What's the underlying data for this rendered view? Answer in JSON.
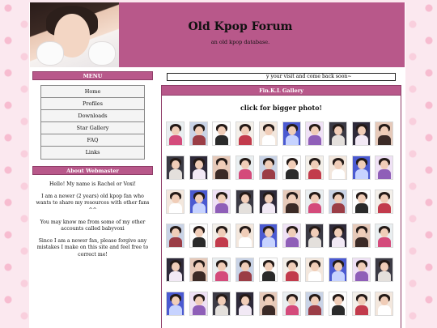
{
  "header": {
    "title": "Old Kpop Forum",
    "subtitle": "an old kpop database."
  },
  "menu": {
    "heading": "MENU",
    "items": [
      "Home",
      "Profiles",
      "Downloads",
      "Star Gallery",
      "FAQ",
      "Links"
    ]
  },
  "about": {
    "heading": "About Webmaster",
    "paragraphs": [
      "Hello! My name is Rachel or Voxi!",
      "I am a newer (2 years) old kpop fan who wants to share my resources with other fans ^^",
      "You may know me from some of my other accounts called babyvoxi",
      "Since I am a newer fan, please forgive any mistakes I make on this site and feel free to correct me!"
    ]
  },
  "marquee": {
    "text": "y your visit and come back soon~"
  },
  "gallery": {
    "heading": "Fin.K.L Gallery",
    "subheading": "click for bigger photo!",
    "thumbnail_count": 60,
    "thumbnail_palette": [
      [
        "#e9eef0",
        "#d44b7b"
      ],
      [
        "#3b3a44",
        "#e4e0dc"
      ],
      [
        "#f3e7dd",
        "#ffffff"
      ],
      [
        "#c9d3e6",
        "#9b3d46"
      ],
      [
        "#2e2a3a",
        "#f2e9f5"
      ],
      [
        "#4b5ad1",
        "#c7d3ff"
      ],
      [
        "#fdfdfd",
        "#2a2a2a"
      ],
      [
        "#e6c9b9",
        "#3b2a26"
      ],
      [
        "#efe1f5",
        "#8f5fb8"
      ],
      [
        "#f3efe9",
        "#c23b4c"
      ]
    ]
  }
}
